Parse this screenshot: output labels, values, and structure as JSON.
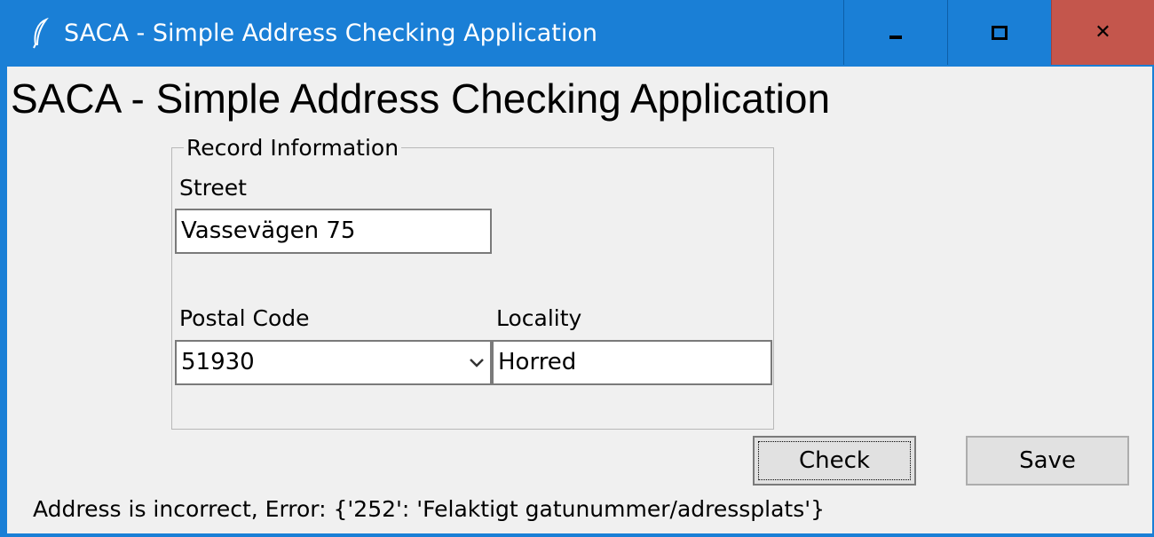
{
  "window": {
    "title": "SACA - Simple Address Checking Application",
    "icon": "feather-icon",
    "controls": {
      "minimize": "minimize-icon",
      "maximize": "maximize-icon",
      "close": "✕"
    }
  },
  "app": {
    "heading": "SACA - Simple Address Checking Application"
  },
  "record": {
    "group_label": "Record Information",
    "street_label": "Street",
    "street_value": "Vassevägen 75",
    "postal_label": "Postal Code",
    "postal_value": "51930",
    "locality_label": "Locality",
    "locality_value": "Horred"
  },
  "buttons": {
    "check": "Check",
    "save": "Save"
  },
  "status": {
    "message": "Address is incorrect, Error: {'252': 'Felaktigt gatunummer/adressplats'}"
  },
  "colors": {
    "titlebar": "#1a7fd6",
    "close_button": "#c4564c",
    "client_bg": "#f0f0f0"
  }
}
